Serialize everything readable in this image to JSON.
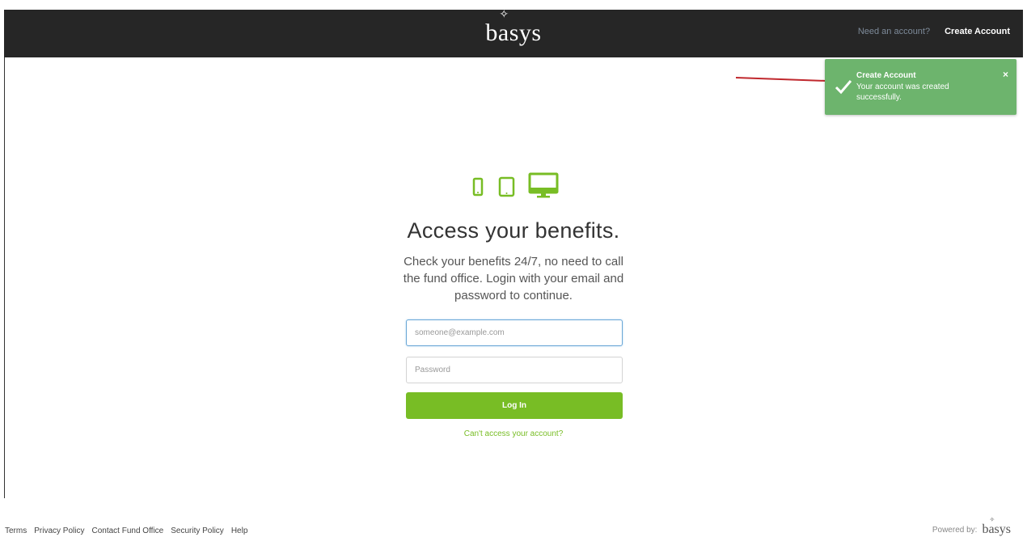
{
  "header": {
    "brand": "basys",
    "need_account": "Need an account?",
    "create_account": "Create Account"
  },
  "toast": {
    "title": "Create Account",
    "message": "Your account was created successfully.",
    "close": "×",
    "color": "#6db46d"
  },
  "main": {
    "headline": "Access your benefits.",
    "subtext": "Check your benefits 24/7, no need to call the fund office. Login with your email and password to continue.",
    "email_placeholder": "someone@example.com",
    "password_placeholder": "Password",
    "login_label": "Log In",
    "forgot_link": "Can't access your account?",
    "accent": "#78bd25",
    "device_icons": [
      "phone-icon",
      "tablet-icon",
      "desktop-icon"
    ]
  },
  "footer": {
    "links": [
      "Terms",
      "Privacy Policy",
      "Contact Fund Office",
      "Security Policy",
      "Help"
    ],
    "powered_by": "Powered by:",
    "powered_brand": "basys"
  }
}
